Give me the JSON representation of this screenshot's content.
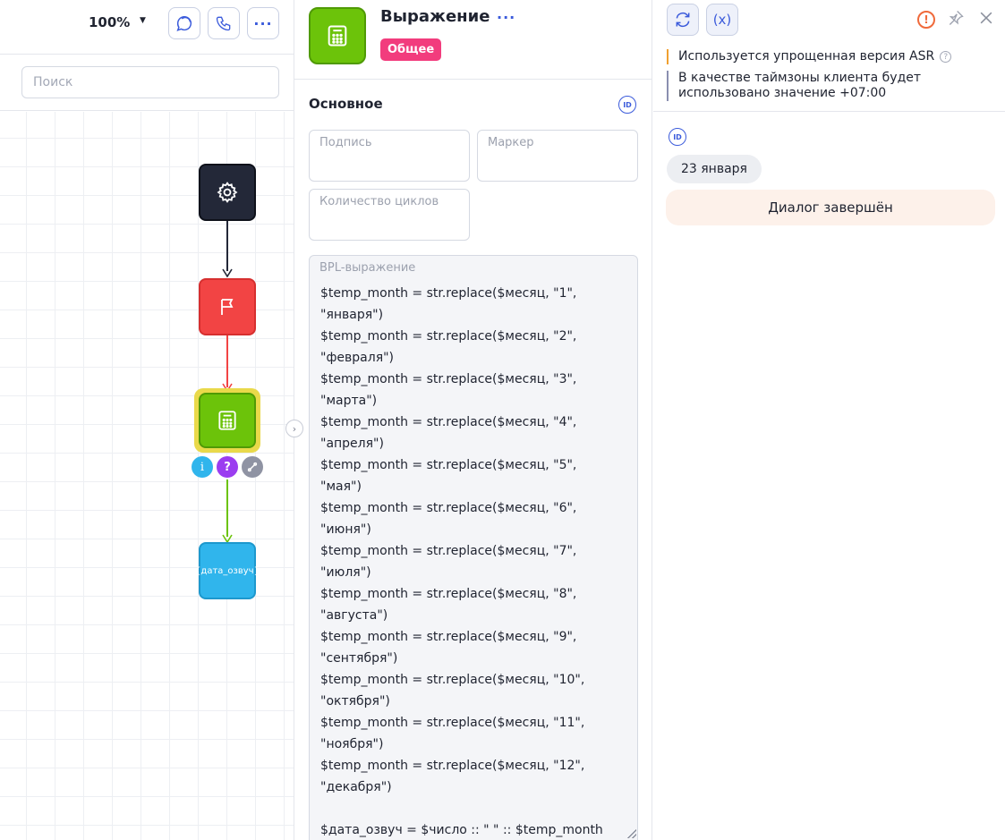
{
  "canvas": {
    "zoom": "100%",
    "search_placeholder": "Поиск",
    "variable_node_label": "{дата_озвуч}",
    "colors": {
      "start": "#232838",
      "flag": "#f24444",
      "expression": "#6cc30a",
      "variable": "#30b5ec",
      "selected_ring": "#e9d94a"
    }
  },
  "block": {
    "title": "Выражение",
    "tag": "Общее",
    "tag_color": "#f23c7d",
    "section_title": "Основное",
    "fields": {
      "caption_label": "Подпись",
      "marker_label": "Маркер",
      "cycles_label": "Количество циклов",
      "bpl_label": "BPL-выражение",
      "bpl_value": "$temp_month = str.replace($месяц, \"1\",\n\"января\")\n$temp_month = str.replace($месяц, \"2\",\n\"февраля\")\n$temp_month = str.replace($месяц, \"3\",\n\"марта\")\n$temp_month = str.replace($месяц, \"4\",\n\"апреля\")\n$temp_month = str.replace($месяц, \"5\",\n\"мая\")\n$temp_month = str.replace($месяц, \"6\",\n\"июня\")\n$temp_month = str.replace($месяц, \"7\",\n\"июля\")\n$temp_month = str.replace($месяц, \"8\",\n\"августа\")\n$temp_month = str.replace($месяц, \"9\",\n\"сентября\")\n$temp_month = str.replace($месяц, \"10\",\n\"октября\")\n$temp_month = str.replace($месяц, \"11\",\n\"ноября\")\n$temp_month = str.replace($месяц, \"12\",\n\"декабря\")\n\n$дата_озвуч = $число :: \" \" :: $temp_month"
    }
  },
  "test_panel": {
    "refresh_icon": "refresh-icon",
    "variables_label": "(x)",
    "notice_asr": "Используется упрощенная версия ASR",
    "notice_timezone": "В качестве таймзоны клиента будет использовано значение +07:00",
    "date_chip": "23 января",
    "dialog_status": "Диалог завершён"
  }
}
